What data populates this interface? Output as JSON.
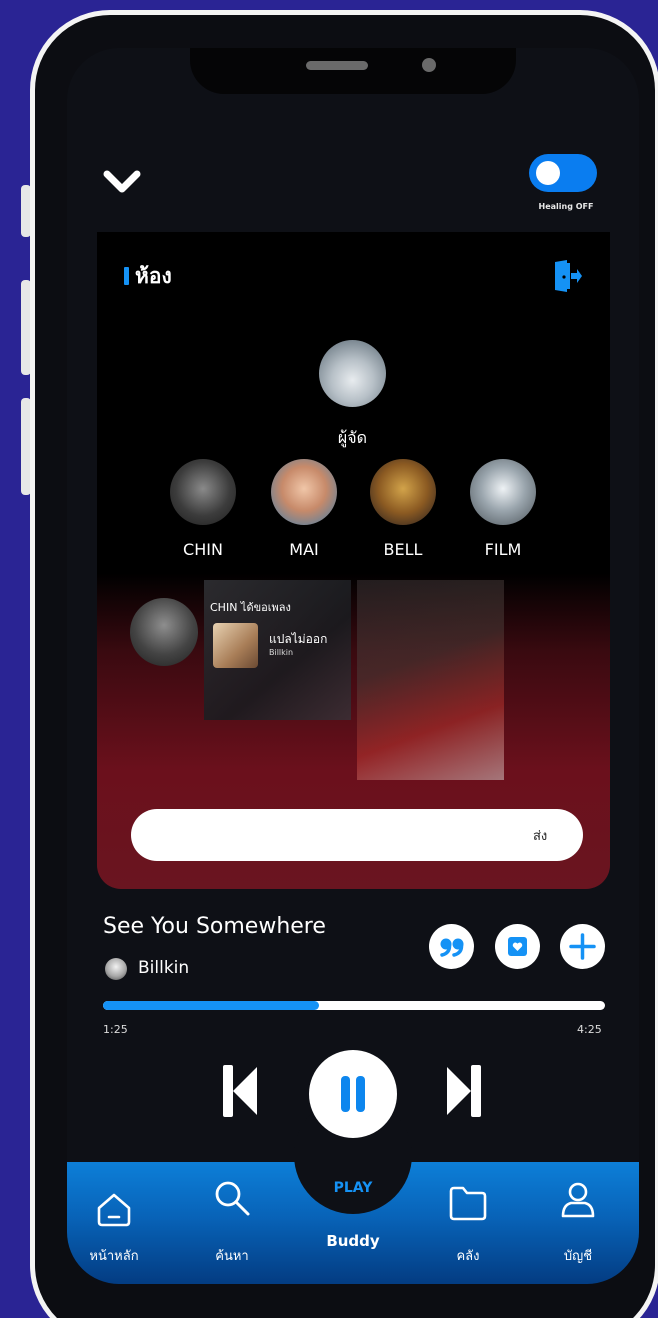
{
  "header": {
    "healing_label": "Healing OFF",
    "healing_on": false
  },
  "room": {
    "title": "ห้อง",
    "host_label": "ผู้จัด",
    "members": [
      "CHIN",
      "MAI",
      "BELL",
      "FILM"
    ],
    "request": {
      "text": "CHIN ได้ขอเพลง",
      "song_title": "แปลไม่ออก",
      "song_artist": "Billkin"
    },
    "chat": {
      "placeholder": "",
      "send_label": "ส่ง"
    }
  },
  "player": {
    "title": "See You Somewhere",
    "artist": "Billkin",
    "progress_fraction": 0.43,
    "elapsed": "1:25",
    "total": "4:25",
    "play_label": "PLAY"
  },
  "tabbar": {
    "items": [
      {
        "label": "หน้าหลัก",
        "icon": "home-icon"
      },
      {
        "label": "ค้นหา",
        "icon": "search-icon"
      },
      {
        "label": "Buddy",
        "icon": "play-center"
      },
      {
        "label": "คลัง",
        "icon": "folder-icon"
      },
      {
        "label": "บัญชี",
        "icon": "user-icon"
      }
    ]
  },
  "colors": {
    "accent": "#1592f5",
    "background": "#2a2494",
    "screen": "#0e1016"
  }
}
